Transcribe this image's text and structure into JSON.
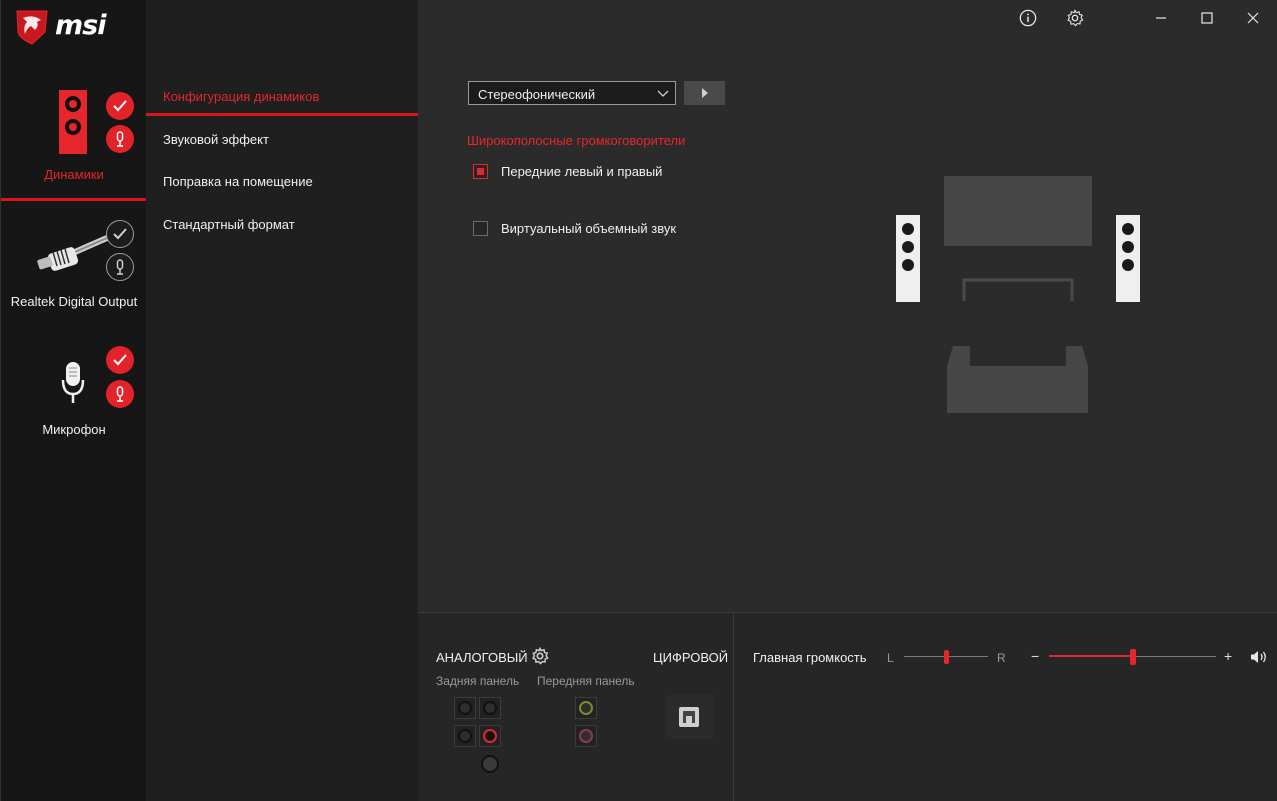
{
  "colors": {
    "accent": "#e5262c",
    "background": "#2b2b2b",
    "sidebar": "#161616",
    "menu": "#1f1f1f"
  },
  "brand": {
    "logo_text": "msi"
  },
  "header": {
    "info_icon": "info-icon",
    "settings_icon": "gear-icon",
    "minimize_icon": "minimize-icon",
    "maximize_icon": "maximize-icon",
    "close_icon": "close-icon"
  },
  "devices": [
    {
      "label": "Динамики",
      "selected": true,
      "default": true,
      "comm_default": true
    },
    {
      "label": "Realtek Digital Output",
      "selected": false,
      "default": false,
      "comm_default": false
    },
    {
      "label": "Микрофон",
      "selected": false,
      "default": true,
      "comm_default": true
    }
  ],
  "menu": [
    {
      "label": "Конфигурация динамиков",
      "active": true
    },
    {
      "label": "Звуковой эффект",
      "active": false
    },
    {
      "label": "Поправка на помещение",
      "active": false
    },
    {
      "label": "Стандартный формат",
      "active": false
    }
  ],
  "config": {
    "speaker_select": {
      "value": "Стереофонический"
    },
    "section_title": "Широкополосные громкоговорители",
    "options": [
      {
        "label": "Передние левый и правый",
        "checked": true
      },
      {
        "label": "Виртуальный объемный звук",
        "checked": false
      }
    ]
  },
  "connectors": {
    "analog_title": "АНАЛОГОВЫЙ",
    "digital_title": "ЦИФРОВОЙ",
    "rear_label": "Задняя панель",
    "front_label": "Передняя панель"
  },
  "volume": {
    "label": "Главная громкость",
    "balance_left": "L",
    "balance_right": "R",
    "minus": "−",
    "plus": "+",
    "balance_value": 0.5,
    "master_value": 0.5
  }
}
